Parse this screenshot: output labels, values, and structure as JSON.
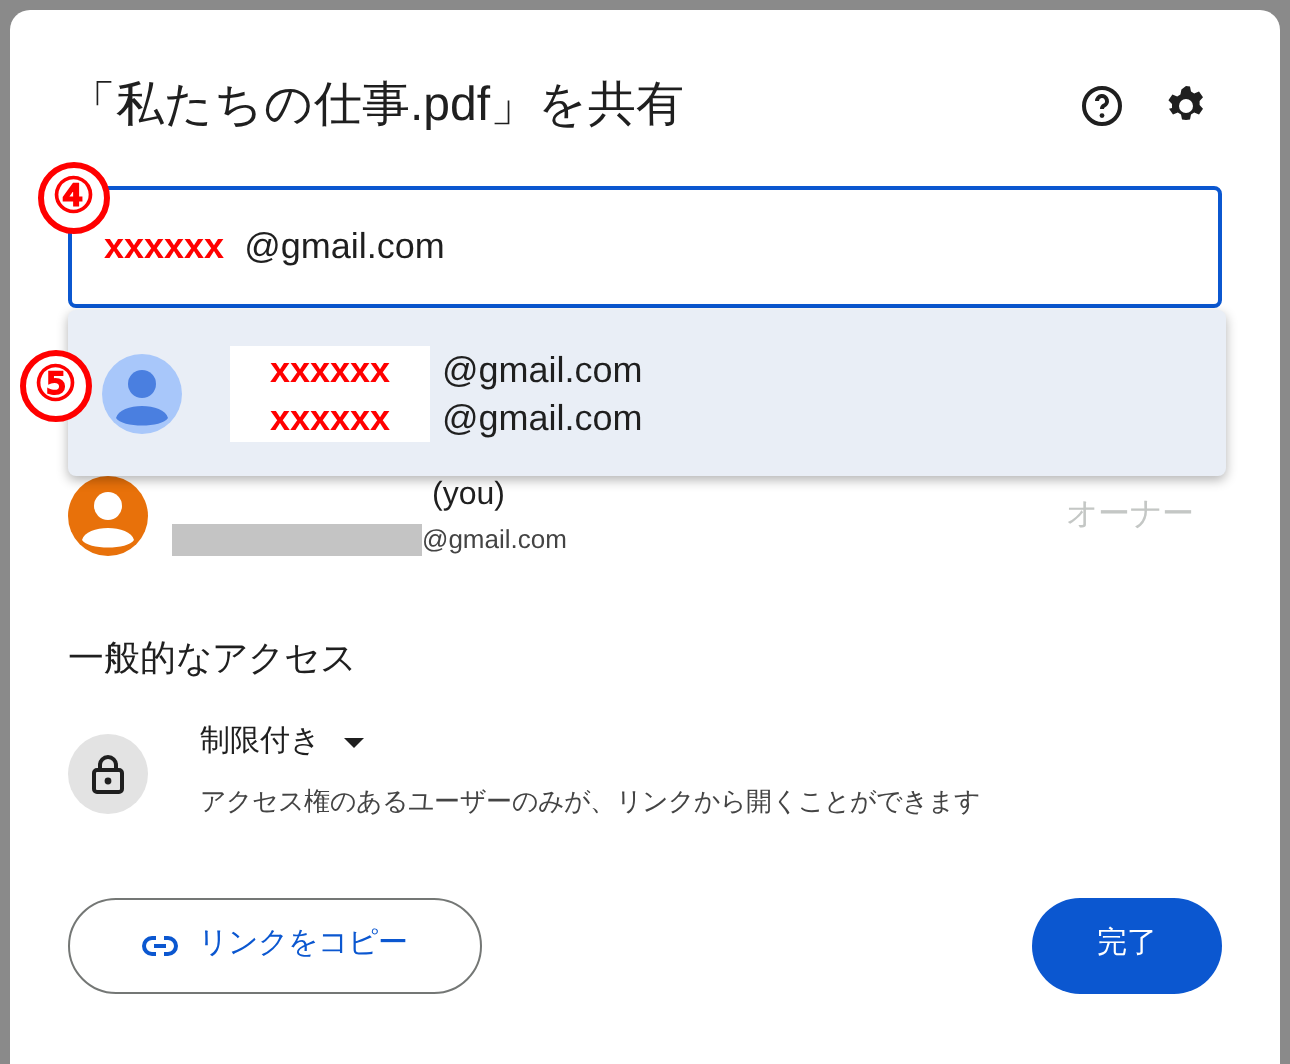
{
  "dialog": {
    "title": "「私たちの仕事.pdf」を共有"
  },
  "share_field": {
    "step_marker": "④",
    "redaction": "xxxxxx",
    "value": "@gmail.com"
  },
  "suggestion": {
    "step_marker": "⑤",
    "lines": [
      {
        "redaction": "xxxxxx",
        "text": "@gmail.com"
      },
      {
        "redaction": "xxxxxx",
        "text": "@gmail.com"
      }
    ]
  },
  "owner": {
    "name_suffix": "(you)",
    "email": "@gmail.com",
    "role": "オーナー"
  },
  "general_access": {
    "heading": "一般的なアクセス",
    "setting": "制限付き",
    "description": "アクセス権のあるユーザーのみが、リンクから開くことができます"
  },
  "buttons": {
    "copy_link": "リンクをコピー",
    "done": "完了"
  }
}
